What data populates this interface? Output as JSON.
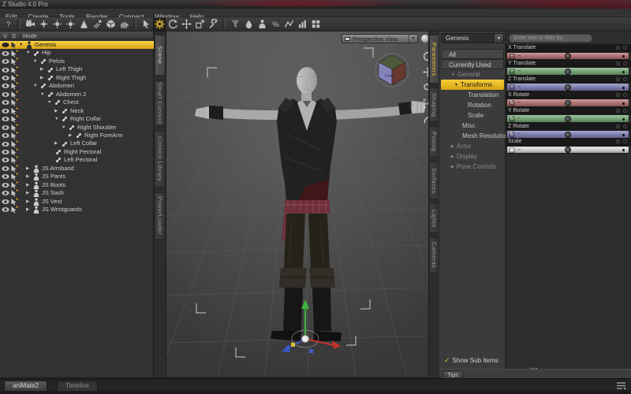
{
  "window": {
    "title": "Z Studio 4.0 Pro"
  },
  "menu": {
    "items": [
      {
        "label": "Edit"
      },
      {
        "label": "Create"
      },
      {
        "label": "Tools"
      },
      {
        "label": "Render"
      },
      {
        "label": "Connect"
      },
      {
        "label": "Window"
      },
      {
        "label": "Help"
      }
    ]
  },
  "toolbar": {
    "accent": "#e9bc28",
    "items": [
      {
        "name": "help",
        "shape": "question"
      },
      {
        "sep": true
      },
      {
        "name": "new-camera",
        "shape": "camera"
      },
      {
        "name": "distant-light",
        "shape": "star"
      },
      {
        "name": "point-light",
        "shape": "bulb"
      },
      {
        "name": "linear-point-light",
        "shape": "bulb"
      },
      {
        "name": "spotlight",
        "shape": "cone"
      },
      {
        "name": "smoothing-brush",
        "shape": "spray"
      },
      {
        "name": "create-primitive",
        "shape": "cube"
      },
      {
        "name": "surface-hand",
        "shape": "hand"
      },
      {
        "sep": true
      },
      {
        "name": "node-selection-tool",
        "shape": "cursor"
      },
      {
        "name": "active-pose-tool",
        "shape": "gear",
        "active": true
      },
      {
        "name": "rotate-tool",
        "shape": "orbit"
      },
      {
        "name": "translate-tool",
        "shape": "move"
      },
      {
        "name": "scale-tool",
        "shape": "scalebox"
      },
      {
        "name": "joint-editor-tool",
        "shape": "wrench"
      },
      {
        "sep": true
      },
      {
        "name": "filter-tool",
        "shape": "funnel",
        "dim": true
      },
      {
        "name": "surface-selection-tool",
        "shape": "paint"
      },
      {
        "name": "figure-setup",
        "shape": "person"
      },
      {
        "name": "powerpose-tool",
        "shape": "percent"
      },
      {
        "name": "dform-tool",
        "shape": "zigzag"
      },
      {
        "name": "measure-metrics",
        "shape": "chart"
      },
      {
        "name": "memorize-pose",
        "shape": "grid"
      }
    ]
  },
  "scene_panel": {
    "columns": [
      "V",
      "S",
      "Node"
    ],
    "items": [
      {
        "label": "Genesis",
        "depth": 0,
        "arrow": "open",
        "icon": "figure",
        "selected": true
      },
      {
        "label": "Hip",
        "depth": 1,
        "arrow": "open",
        "icon": "bone"
      },
      {
        "label": "Pelvis",
        "depth": 2,
        "arrow": "open",
        "icon": "bone"
      },
      {
        "label": "Left Thigh",
        "depth": 3,
        "arrow": "closed",
        "icon": "bone"
      },
      {
        "label": "Right Thigh",
        "depth": 3,
        "arrow": "closed",
        "icon": "bone"
      },
      {
        "label": "Abdomen",
        "depth": 2,
        "arrow": "open",
        "icon": "bone"
      },
      {
        "label": "Abdomen 2",
        "depth": 3,
        "arrow": "open",
        "icon": "bone"
      },
      {
        "label": "Chest",
        "depth": 4,
        "arrow": "open",
        "icon": "bone"
      },
      {
        "label": "Neck",
        "depth": 5,
        "arrow": "closed",
        "icon": "bone"
      },
      {
        "label": "Right Collar",
        "depth": 5,
        "arrow": "open",
        "icon": "bone"
      },
      {
        "label": "Right Shoulder",
        "depth": 6,
        "arrow": "open",
        "icon": "bone"
      },
      {
        "label": "Right ForeArm",
        "depth": 7,
        "arrow": "closed",
        "icon": "bone"
      },
      {
        "label": "Left Collar",
        "depth": 5,
        "arrow": "closed",
        "icon": "bone"
      },
      {
        "label": "Right Pectoral",
        "depth": 5,
        "arrow": "none",
        "icon": "bone"
      },
      {
        "label": "Left Pectoral",
        "depth": 5,
        "arrow": "none",
        "icon": "bone"
      },
      {
        "label": "JS Armband",
        "depth": 1,
        "arrow": "closed",
        "icon": "figure"
      },
      {
        "label": "JS Pants",
        "depth": 1,
        "arrow": "closed",
        "icon": "figure"
      },
      {
        "label": "JS Boots",
        "depth": 1,
        "arrow": "closed",
        "icon": "figure"
      },
      {
        "label": "JS Sash",
        "depth": 1,
        "arrow": "closed",
        "icon": "figure"
      },
      {
        "label": "JS Vest",
        "depth": 1,
        "arrow": "closed",
        "icon": "figure"
      },
      {
        "label": "JS Wristguards",
        "depth": 1,
        "arrow": "closed",
        "icon": "figure"
      }
    ]
  },
  "left_tabs": [
    {
      "label": "Scene",
      "active": true
    },
    {
      "label": "Smart Content"
    },
    {
      "label": "Content Library"
    },
    {
      "label": "PowerLoader"
    }
  ],
  "right_tabs": [
    {
      "label": "Parameters",
      "active": true
    },
    {
      "label": "Shaping"
    },
    {
      "label": "Posing"
    },
    {
      "label": "Surfaces"
    },
    {
      "label": "Lights"
    },
    {
      "label": "Cameras"
    }
  ],
  "viewport": {
    "view_selector": "Perspective View",
    "cube_label": "Front",
    "nav_icons": [
      {
        "name": "orbit-rotate",
        "shape": "orbit"
      },
      {
        "name": "pan",
        "shape": "move"
      },
      {
        "name": "dolly-zoom",
        "shape": "magnifier"
      },
      {
        "name": "frame",
        "shape": "frame"
      },
      {
        "name": "reset-view",
        "shape": "home"
      }
    ],
    "selection_color": "#f2c21f"
  },
  "parameters_panel": {
    "scope": "Genesis",
    "nav": [
      {
        "label": "All",
        "kind": "button"
      },
      {
        "label": "Currently Used",
        "kind": "button"
      },
      {
        "label": "General",
        "kind": "group",
        "arrow": "down"
      },
      {
        "label": "Transforms",
        "kind": "selected",
        "arrow": "down"
      },
      {
        "label": "Translation",
        "kind": "child"
      },
      {
        "label": "Rotation",
        "kind": "child"
      },
      {
        "label": "Scale",
        "kind": "child"
      },
      {
        "label": "Misc",
        "kind": "sub"
      },
      {
        "label": "Mesh Resolution",
        "kind": "sub"
      },
      {
        "label": "Actor",
        "kind": "group",
        "arrow": "right"
      },
      {
        "label": "Display",
        "kind": "group",
        "arrow": "right"
      },
      {
        "label": "Pose Controls",
        "kind": "group",
        "arrow": "right"
      }
    ],
    "show_sub_items_label": "Show Sub Items",
    "show_sub_items_checked": true
  },
  "sliders": {
    "filter_placeholder": "Enter text to filter by...",
    "rows": [
      {
        "label": "X Translate",
        "color": "#b06f6f",
        "type": "translate"
      },
      {
        "label": "Y Translate",
        "color": "#74a374",
        "type": "translate"
      },
      {
        "label": "Z Translate",
        "color": "#7d7db3",
        "type": "translate"
      },
      {
        "label": "X Rotate",
        "color": "#b06f6f",
        "type": "rotate"
      },
      {
        "label": "Y Rotate",
        "color": "#74a374",
        "type": "rotate"
      },
      {
        "label": "Z Rotate",
        "color": "#7d7db3",
        "type": "rotate"
      },
      {
        "label": "Scale",
        "color": "#d4d4d4",
        "type": "scale"
      }
    ]
  },
  "tips": {
    "label": "Tips"
  },
  "bottom_bar": {
    "tabs": [
      {
        "label": "aniMate2",
        "active": true
      },
      {
        "label": "Timeline",
        "active": false
      }
    ]
  }
}
